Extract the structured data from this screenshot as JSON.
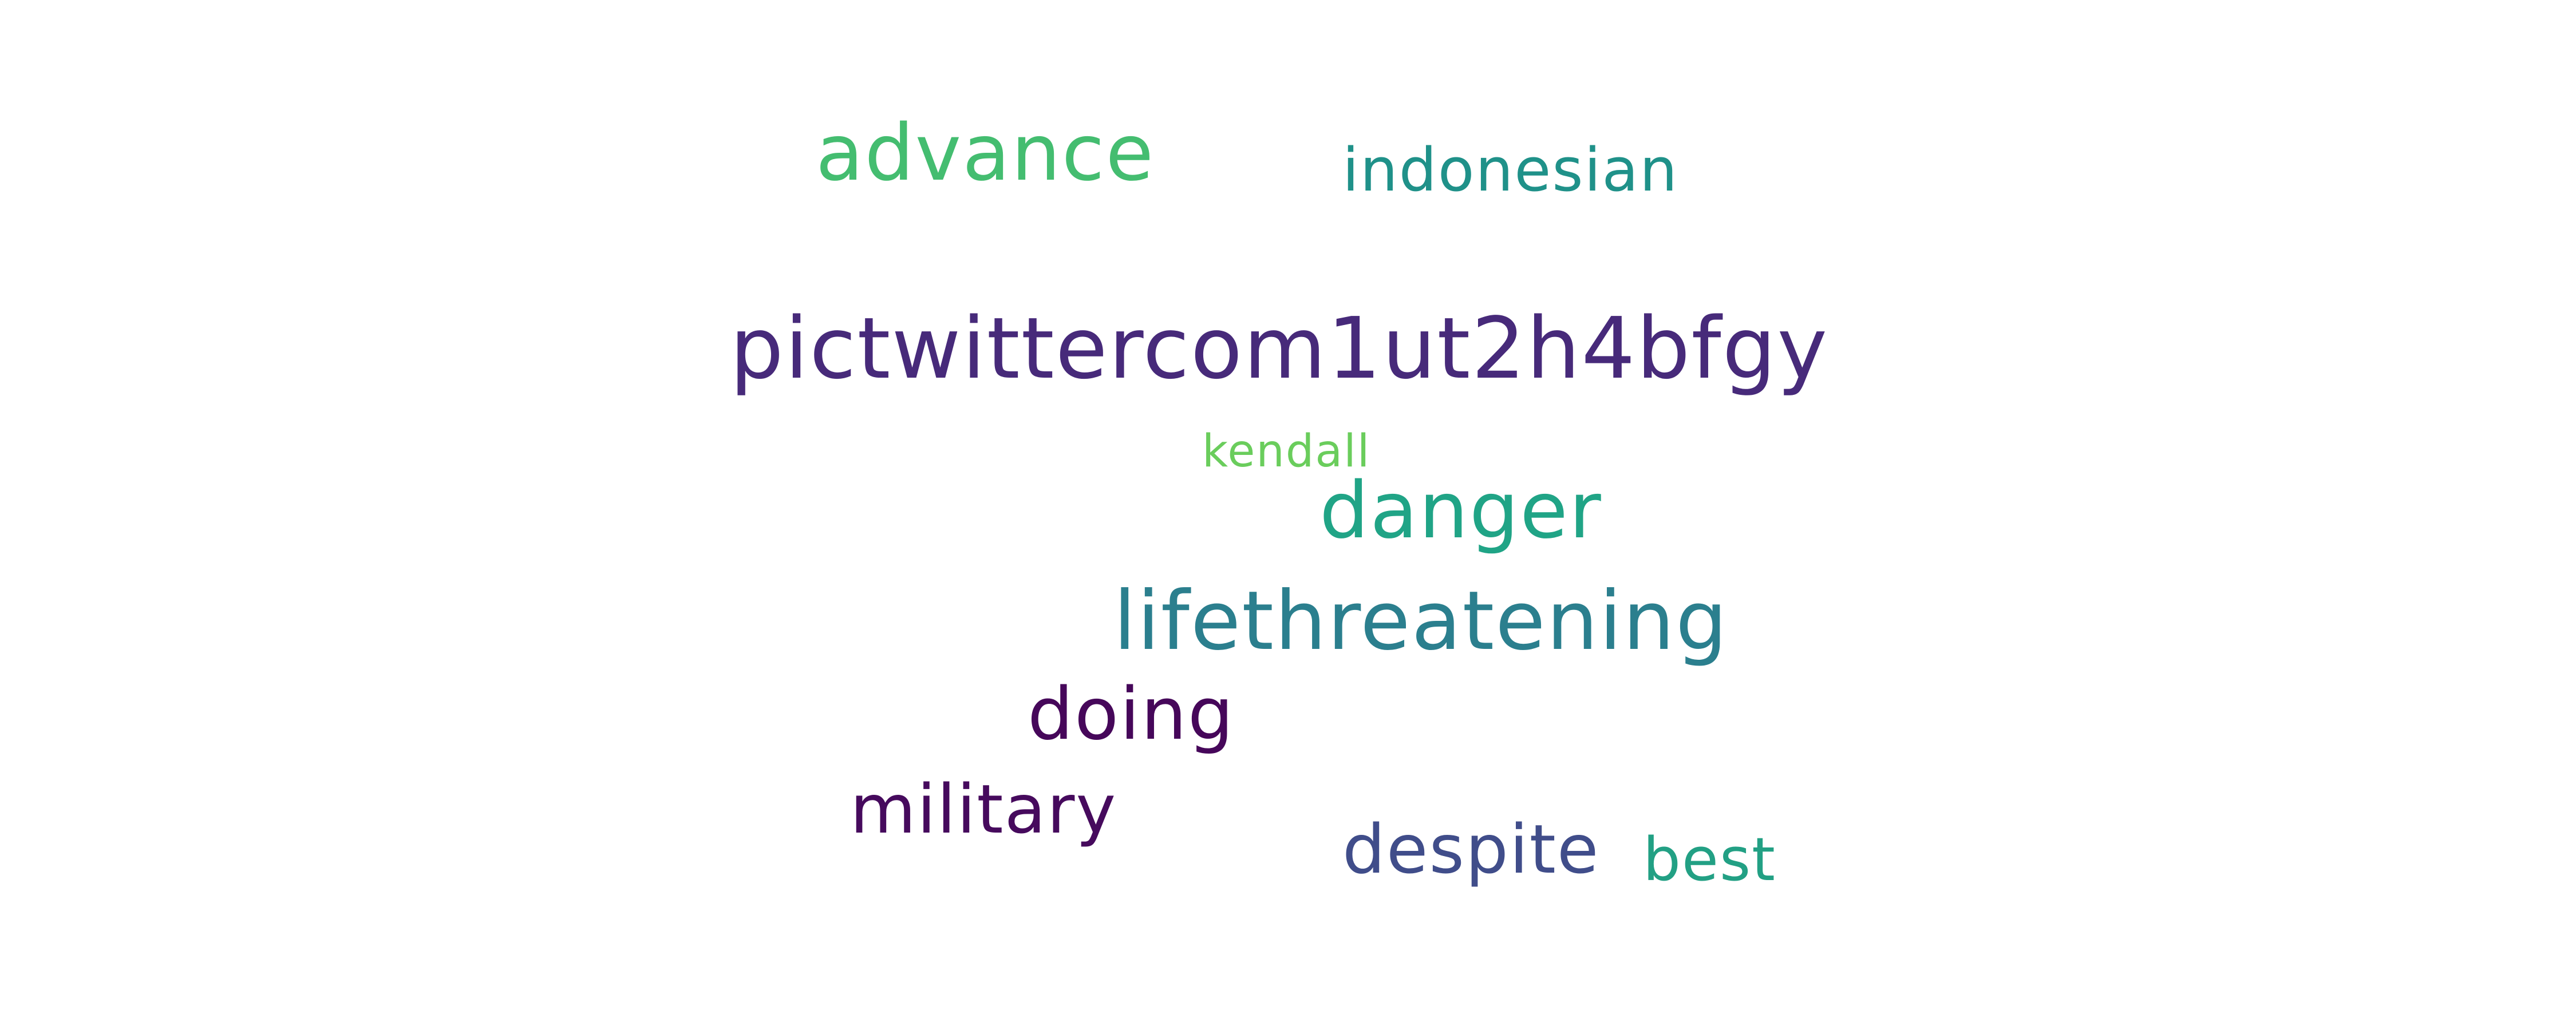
{
  "words": [
    {
      "text": "pictwittercom1ut2h4bfgy",
      "color": "#472a7a"
    },
    {
      "text": "lifethreatening",
      "color": "#2b7f8e"
    },
    {
      "text": "advance",
      "color": "#44bd70"
    },
    {
      "text": "danger",
      "color": "#20a486"
    },
    {
      "text": "doing",
      "color": "#46075a"
    },
    {
      "text": "military",
      "color": "#460a5d"
    },
    {
      "text": "despite",
      "color": "#404d8a"
    },
    {
      "text": "indonesian",
      "color": "#1f9189"
    },
    {
      "text": "best",
      "color": "#22a084"
    },
    {
      "text": "kendall",
      "color": "#6acd5c"
    }
  ]
}
